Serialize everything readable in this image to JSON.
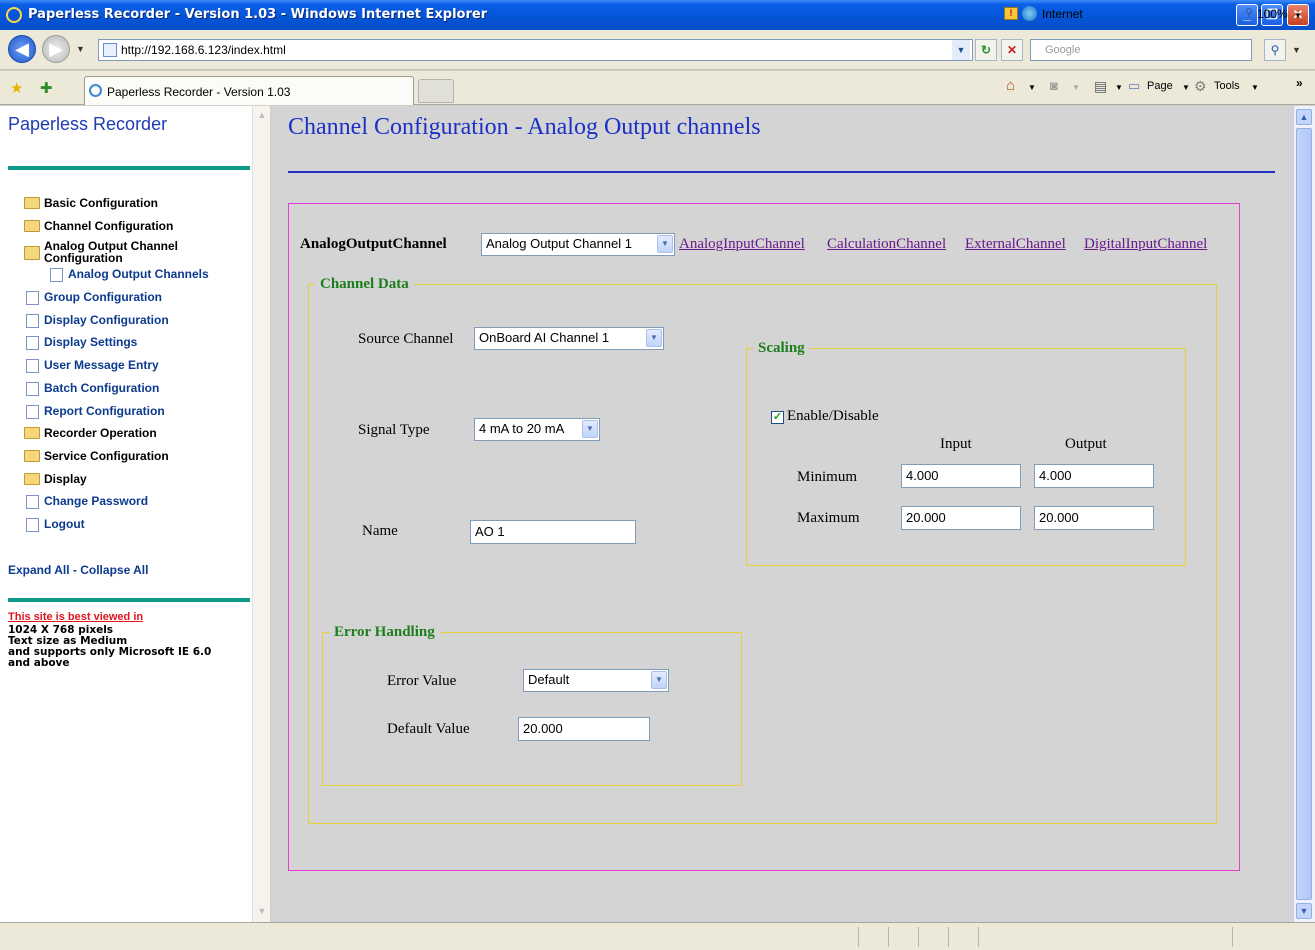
{
  "window": {
    "title": "Paperless Recorder - Version 1.03 - Windows Internet Explorer"
  },
  "address": {
    "url": "http://192.168.6.123/index.html",
    "search_placeholder": "Google"
  },
  "tabs": [
    {
      "label": "Paperless Recorder - Version 1.03"
    }
  ],
  "commandbar": {
    "page": "Page",
    "tools": "Tools"
  },
  "sidebar": {
    "title": "Paperless Recorder",
    "items": [
      {
        "label": "Basic Configuration",
        "icon": "folder-icon"
      },
      {
        "label": "Channel Configuration",
        "icon": "folder-icon"
      },
      {
        "label": "Analog Output Channel Configuration",
        "icon": "open-folder-icon"
      },
      {
        "label": "Analog Output Channels",
        "icon": "page-icon"
      },
      {
        "label": "Group Configuration",
        "icon": "page-icon"
      },
      {
        "label": "Display Configuration",
        "icon": "page-icon"
      },
      {
        "label": "Display Settings",
        "icon": "page-icon"
      },
      {
        "label": "User Message Entry",
        "icon": "page-icon"
      },
      {
        "label": "Batch Configuration",
        "icon": "page-icon"
      },
      {
        "label": "Report Configuration",
        "icon": "page-icon"
      },
      {
        "label": "Recorder Operation",
        "icon": "folder-icon"
      },
      {
        "label": "Service Configuration",
        "icon": "folder-icon"
      },
      {
        "label": "Display",
        "icon": "folder-icon"
      },
      {
        "label": "Change Password",
        "icon": "page-icon"
      },
      {
        "label": "Logout",
        "icon": "page-icon"
      }
    ],
    "expand_collapse": "Expand All - Collapse All",
    "note_link": "This site is best viewed in",
    "note_lines": [
      "1024 X 768 pixels",
      "Text size as Medium",
      "and supports only Microsoft IE 6.0",
      "and above"
    ]
  },
  "main": {
    "title": "Channel Configuration - Analog Output channels",
    "channel_label": "AnalogOutputChannel",
    "channel_select": "Analog Output Channel 1",
    "links": [
      "AnalogInputChannel",
      "CalculationChannel",
      "ExternalChannel",
      "DigitalInputChannel"
    ],
    "channel_data": {
      "legend": "Channel Data",
      "source_label": "Source Channel",
      "source_value": "OnBoard AI Channel 1",
      "signal_label": "Signal Type",
      "signal_value": "4 mA to 20 mA",
      "name_label": "Name",
      "name_value": "AO 1"
    },
    "scaling": {
      "legend": "Scaling",
      "enable_label": "Enable/Disable",
      "enabled": true,
      "input_header": "Input",
      "output_header": "Output",
      "min_label": "Minimum",
      "max_label": "Maximum",
      "min_input": "4.000",
      "min_output": "4.000",
      "max_input": "20.000",
      "max_output": "20.000"
    },
    "error_handling": {
      "legend": "Error Handling",
      "error_value_label": "Error Value",
      "error_value": "Default",
      "default_value_label": "Default Value",
      "default_value": "20.000"
    }
  },
  "status": {
    "zone": "Internet",
    "zoom": "100%"
  },
  "colors": {
    "title_blue": "#1c30c8",
    "legend_green": "#1e7e1e",
    "fieldset_yellow": "#e6d236",
    "outer_magenta": "#e23fd6",
    "sidebar_teal": "#0e9a8a"
  }
}
